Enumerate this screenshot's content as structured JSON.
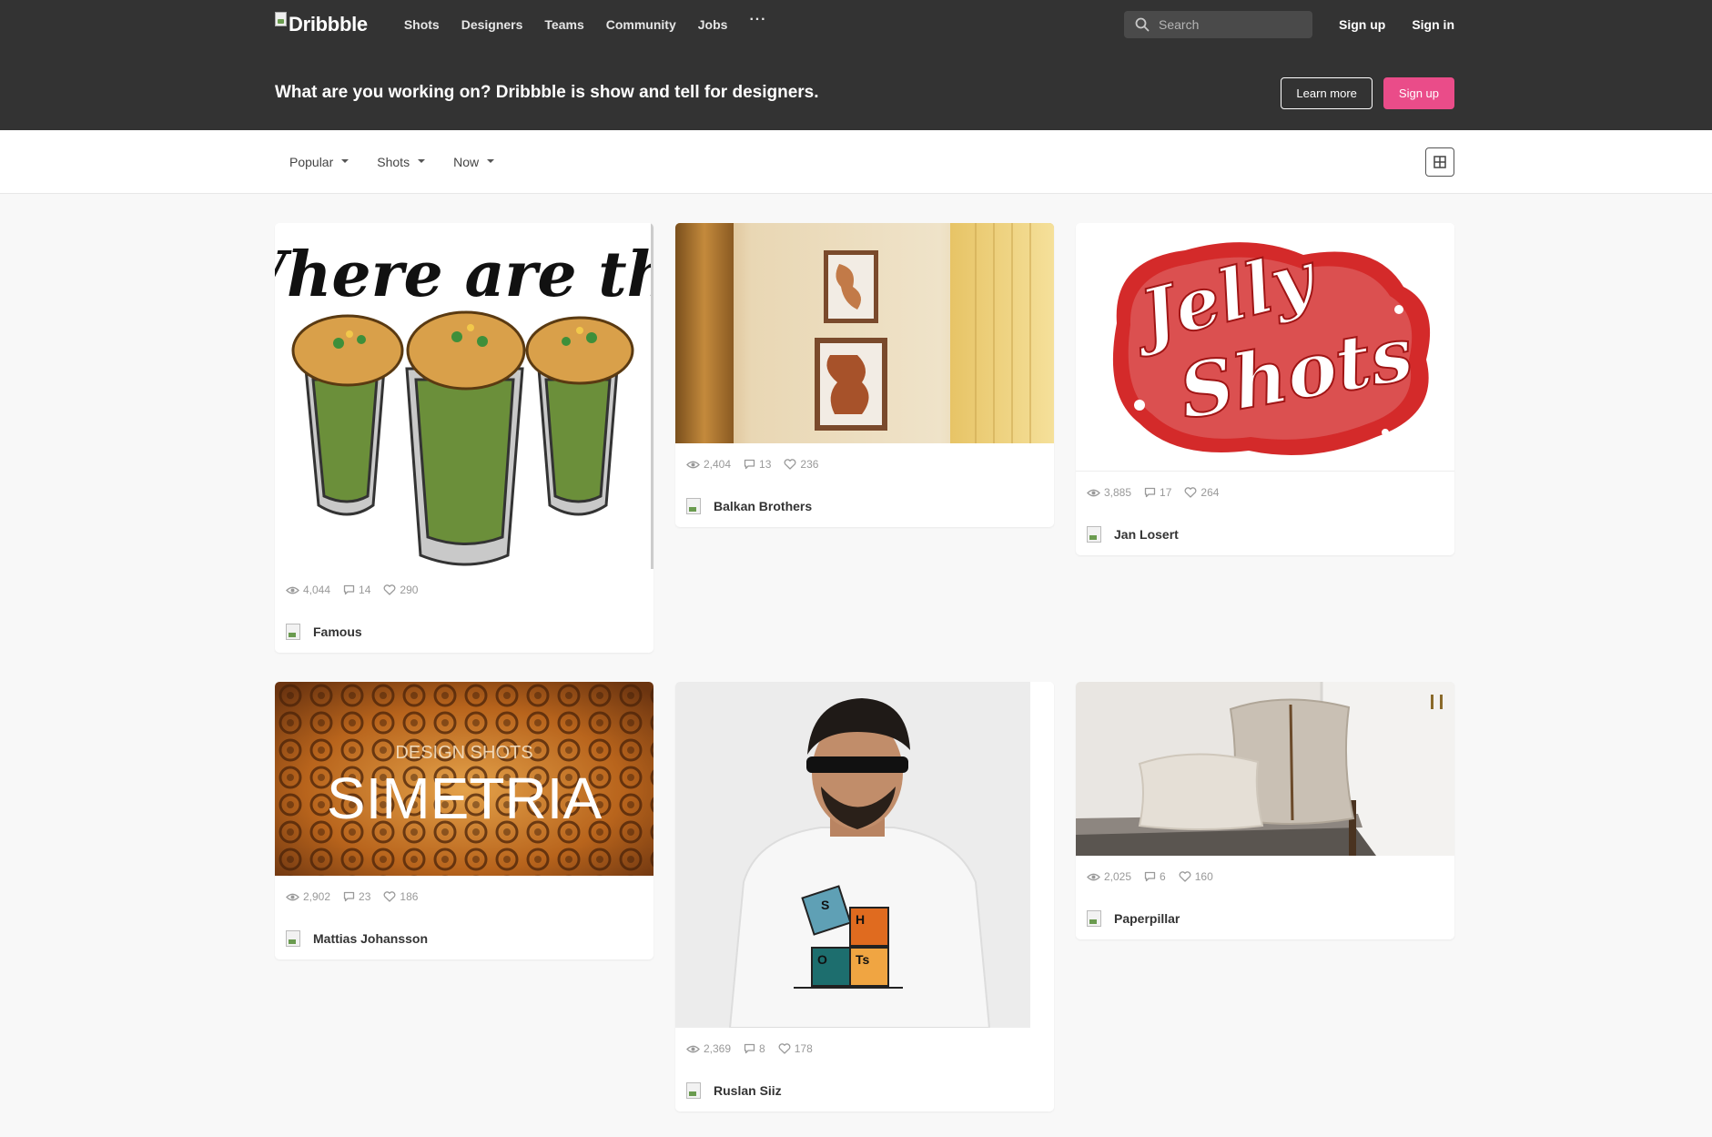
{
  "nav": {
    "logo": "Dribbble",
    "links": [
      "Shots",
      "Designers",
      "Teams",
      "Community",
      "Jobs"
    ],
    "more": "···",
    "search_placeholder": "Search",
    "sign_up": "Sign up",
    "sign_in": "Sign in"
  },
  "hero": {
    "text": "What are you working on? Dribbble is show and tell for designers.",
    "learn_more": "Learn more",
    "sign_up": "Sign up"
  },
  "filters": {
    "sort": "Popular",
    "type": "Shots",
    "time": "Now"
  },
  "colors": {
    "topbar": "#333333",
    "accent": "#ea4c89",
    "background": "#f8f8f8"
  },
  "shots": [
    {
      "views": "4,044",
      "comments": "14",
      "likes": "290",
      "author": "Famous",
      "image": "pani-puri-shots-illustration",
      "headline": "Where are the"
    },
    {
      "views": "2,404",
      "comments": "13",
      "likes": "236",
      "author": "Balkan Brothers",
      "image": "framed-art-on-wall-photo"
    },
    {
      "views": "3,885",
      "comments": "17",
      "likes": "264",
      "author": "Jan Losert",
      "image": "jelly-shots-lettering"
    },
    {
      "views": "2,902",
      "comments": "23",
      "likes": "186",
      "author": "Mattias Johansson",
      "image": "simetria-pattern",
      "subtitle": "DESIGN SHOTS",
      "headline": "SIMETRIA"
    },
    {
      "views": "2,369",
      "comments": "8",
      "likes": "178",
      "author": "Ruslan Siiz",
      "image": "man-in-periodic-shots-tshirt"
    },
    {
      "views": "2,025",
      "comments": "6",
      "likes": "160",
      "author": "Paperpillar",
      "image": "pillows-on-bench-photo"
    }
  ]
}
